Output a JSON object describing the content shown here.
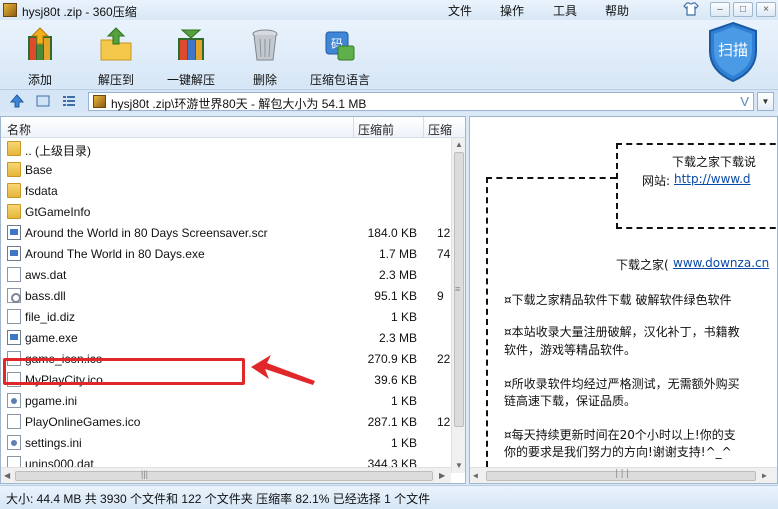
{
  "window": {
    "title": "hysj80t .zip - 360压缩",
    "menu": [
      "文件",
      "操作",
      "工具",
      "帮助"
    ],
    "controls": {
      "minimize": "–",
      "maximize": "□",
      "close": "×"
    }
  },
  "toolbar": {
    "buttons": [
      {
        "label": "添加",
        "icon": "add-books-icon"
      },
      {
        "label": "解压到",
        "icon": "extract-folder-icon"
      },
      {
        "label": "一键解压",
        "icon": "one-click-extract-icon"
      },
      {
        "label": "删除",
        "icon": "trash-icon"
      },
      {
        "label": "压缩包语言",
        "icon": "archive-language-icon"
      }
    ],
    "scan_label": "扫描"
  },
  "address": {
    "path": "hysj80t .zip\\环游世界80天 - 解包大小为 54.1 MB",
    "v_label": "V"
  },
  "file_list": {
    "columns": [
      "名称",
      "压缩前",
      "压缩"
    ],
    "rows": [
      {
        "name": ".. (上级目录)",
        "size": "",
        "packed": "",
        "type": "folder"
      },
      {
        "name": "Base",
        "size": "",
        "packed": "",
        "type": "folder"
      },
      {
        "name": "fsdata",
        "size": "",
        "packed": "",
        "type": "folder"
      },
      {
        "name": "GtGameInfo",
        "size": "",
        "packed": "",
        "type": "folder"
      },
      {
        "name": "Around the World in 80 Days Screensaver.scr",
        "size": "184.0 KB",
        "packed": "12",
        "type": "exe"
      },
      {
        "name": "Around The World in 80 Days.exe",
        "size": "1.7 MB",
        "packed": "74",
        "type": "exe"
      },
      {
        "name": "aws.dat",
        "size": "2.3 MB",
        "packed": "",
        "type": "file"
      },
      {
        "name": "bass.dll",
        "size": "95.1 KB",
        "packed": "9",
        "type": "dll"
      },
      {
        "name": "file_id.diz",
        "size": "1 KB",
        "packed": "",
        "type": "file"
      },
      {
        "name": "game.exe",
        "size": "2.3 MB",
        "packed": "",
        "type": "exe"
      },
      {
        "name": "game_icon.ico",
        "size": "270.9 KB",
        "packed": "22",
        "type": "file"
      },
      {
        "name": "MyPlayCity.ico",
        "size": "39.6 KB",
        "packed": "",
        "type": "file"
      },
      {
        "name": "pgame.ini",
        "size": "1 KB",
        "packed": "",
        "type": "ini"
      },
      {
        "name": "PlayOnlineGames.ico",
        "size": "287.1 KB",
        "packed": "12",
        "type": "file"
      },
      {
        "name": "settings.ini",
        "size": "1 KB",
        "packed": "",
        "type": "ini"
      },
      {
        "name": "unins000.dat",
        "size": "344.3 KB",
        "packed": "",
        "type": "file"
      }
    ]
  },
  "preview": {
    "banner_title": "下载之家下载说",
    "banner_site_label": "网站:",
    "banner_site_url": "http://www.d",
    "home_prefix": "下载之家(",
    "home_url": "www.downza.cn",
    "bullets": [
      [
        "¤下载之家精品软件下载 破解软件绿色软件"
      ],
      [
        "¤本站收录大量注册破解，汉化补丁，书籍教",
        "  软件，游戏等精品软件。"
      ],
      [
        "¤所收录软件均经过严格测试，无需额外购买",
        "  链高速下载，保证品质。"
      ],
      [
        "¤每天持续更新时间在20个小时以上!你的支",
        "  你的要求是我们努力的方向!谢谢支持!^_^"
      ]
    ]
  },
  "status": {
    "text": "大小: 44.4 MB 共 3930 个文件和 122 个文件夹 压缩率 82.1% 已经选择 1 个文件"
  },
  "colors": {
    "accent": "#3d77c7",
    "highlight": "#e0282a",
    "link": "#0a4aa8"
  }
}
